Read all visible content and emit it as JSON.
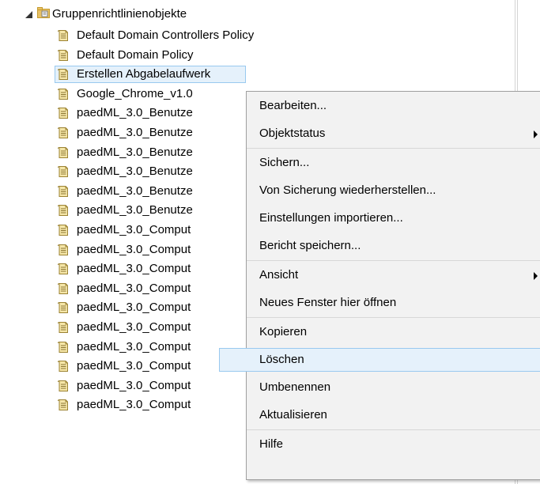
{
  "tree": {
    "root_label": "Gruppenrichtlinienobjekte",
    "items": [
      {
        "label": "Default Domain Controllers Policy"
      },
      {
        "label": "Default Domain Policy"
      },
      {
        "label": "Erstellen Abgabelaufwerk",
        "selected": true
      },
      {
        "label": "Google_Chrome_v1.0"
      },
      {
        "label": "paedML_3.0_Benutze"
      },
      {
        "label": "paedML_3.0_Benutze"
      },
      {
        "label": "paedML_3.0_Benutze"
      },
      {
        "label": "paedML_3.0_Benutze"
      },
      {
        "label": "paedML_3.0_Benutze"
      },
      {
        "label": "paedML_3.0_Benutze"
      },
      {
        "label": "paedML_3.0_Comput"
      },
      {
        "label": "paedML_3.0_Comput"
      },
      {
        "label": "paedML_3.0_Comput"
      },
      {
        "label": "paedML_3.0_Comput"
      },
      {
        "label": "paedML_3.0_Comput"
      },
      {
        "label": "paedML_3.0_Comput"
      },
      {
        "label": "paedML_3.0_Comput"
      },
      {
        "label": "paedML_3.0_Comput"
      },
      {
        "label": "paedML_3.0_Comput"
      },
      {
        "label": "paedML_3.0_Comput"
      }
    ]
  },
  "context_menu": {
    "items": [
      {
        "label": "Bearbeiten..."
      },
      {
        "label": "Objektstatus",
        "submenu": true
      },
      {
        "label": "Sichern..."
      },
      {
        "label": "Von Sicherung wiederherstellen..."
      },
      {
        "label": "Einstellungen importieren..."
      },
      {
        "label": "Bericht speichern..."
      },
      {
        "label": "Ansicht",
        "submenu": true
      },
      {
        "label": "Neues Fenster hier öffnen"
      },
      {
        "label": "Kopieren"
      },
      {
        "label": "Löschen",
        "highlighted": true
      },
      {
        "label": "Umbenennen"
      },
      {
        "label": "Aktualisieren"
      },
      {
        "label": "Hilfe"
      }
    ]
  },
  "colors": {
    "selection_fill": "#e5f1fb",
    "selection_border": "#99c9ef",
    "menu_background": "#f2f2f2"
  },
  "icons": {
    "root": "folder-gpo-icon",
    "item": "gpo-document-icon",
    "expander": "expanded-triangle-icon",
    "submenu": "submenu-arrow-icon"
  }
}
